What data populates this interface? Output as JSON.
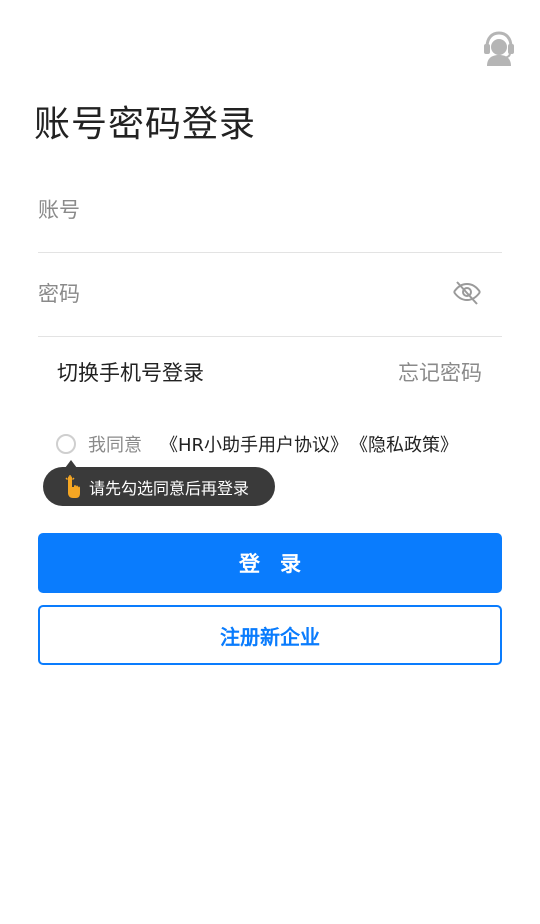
{
  "header": {
    "support_icon": "customer-service-icon",
    "title": "账号密码登录"
  },
  "form": {
    "account_placeholder": "账号",
    "account_value": "",
    "password_placeholder": "密码",
    "password_value": "",
    "password_toggle_icon": "eye-closed-icon"
  },
  "options": {
    "switch_login": "切换手机号登录",
    "forgot_password": "忘记密码"
  },
  "agreement": {
    "checked": false,
    "prefix": "我同意",
    "user_agreement": "《HR小助手用户协议》",
    "privacy_policy": "《隐私政策》"
  },
  "tooltip": {
    "icon": "hand-pointer-icon",
    "text": "请先勾选同意后再登录"
  },
  "buttons": {
    "login": "登录",
    "register": "注册新企业"
  },
  "colors": {
    "primary": "#0a7cfd",
    "tooltip_bg": "#3a3a3a",
    "placeholder": "#8a8a8a"
  }
}
